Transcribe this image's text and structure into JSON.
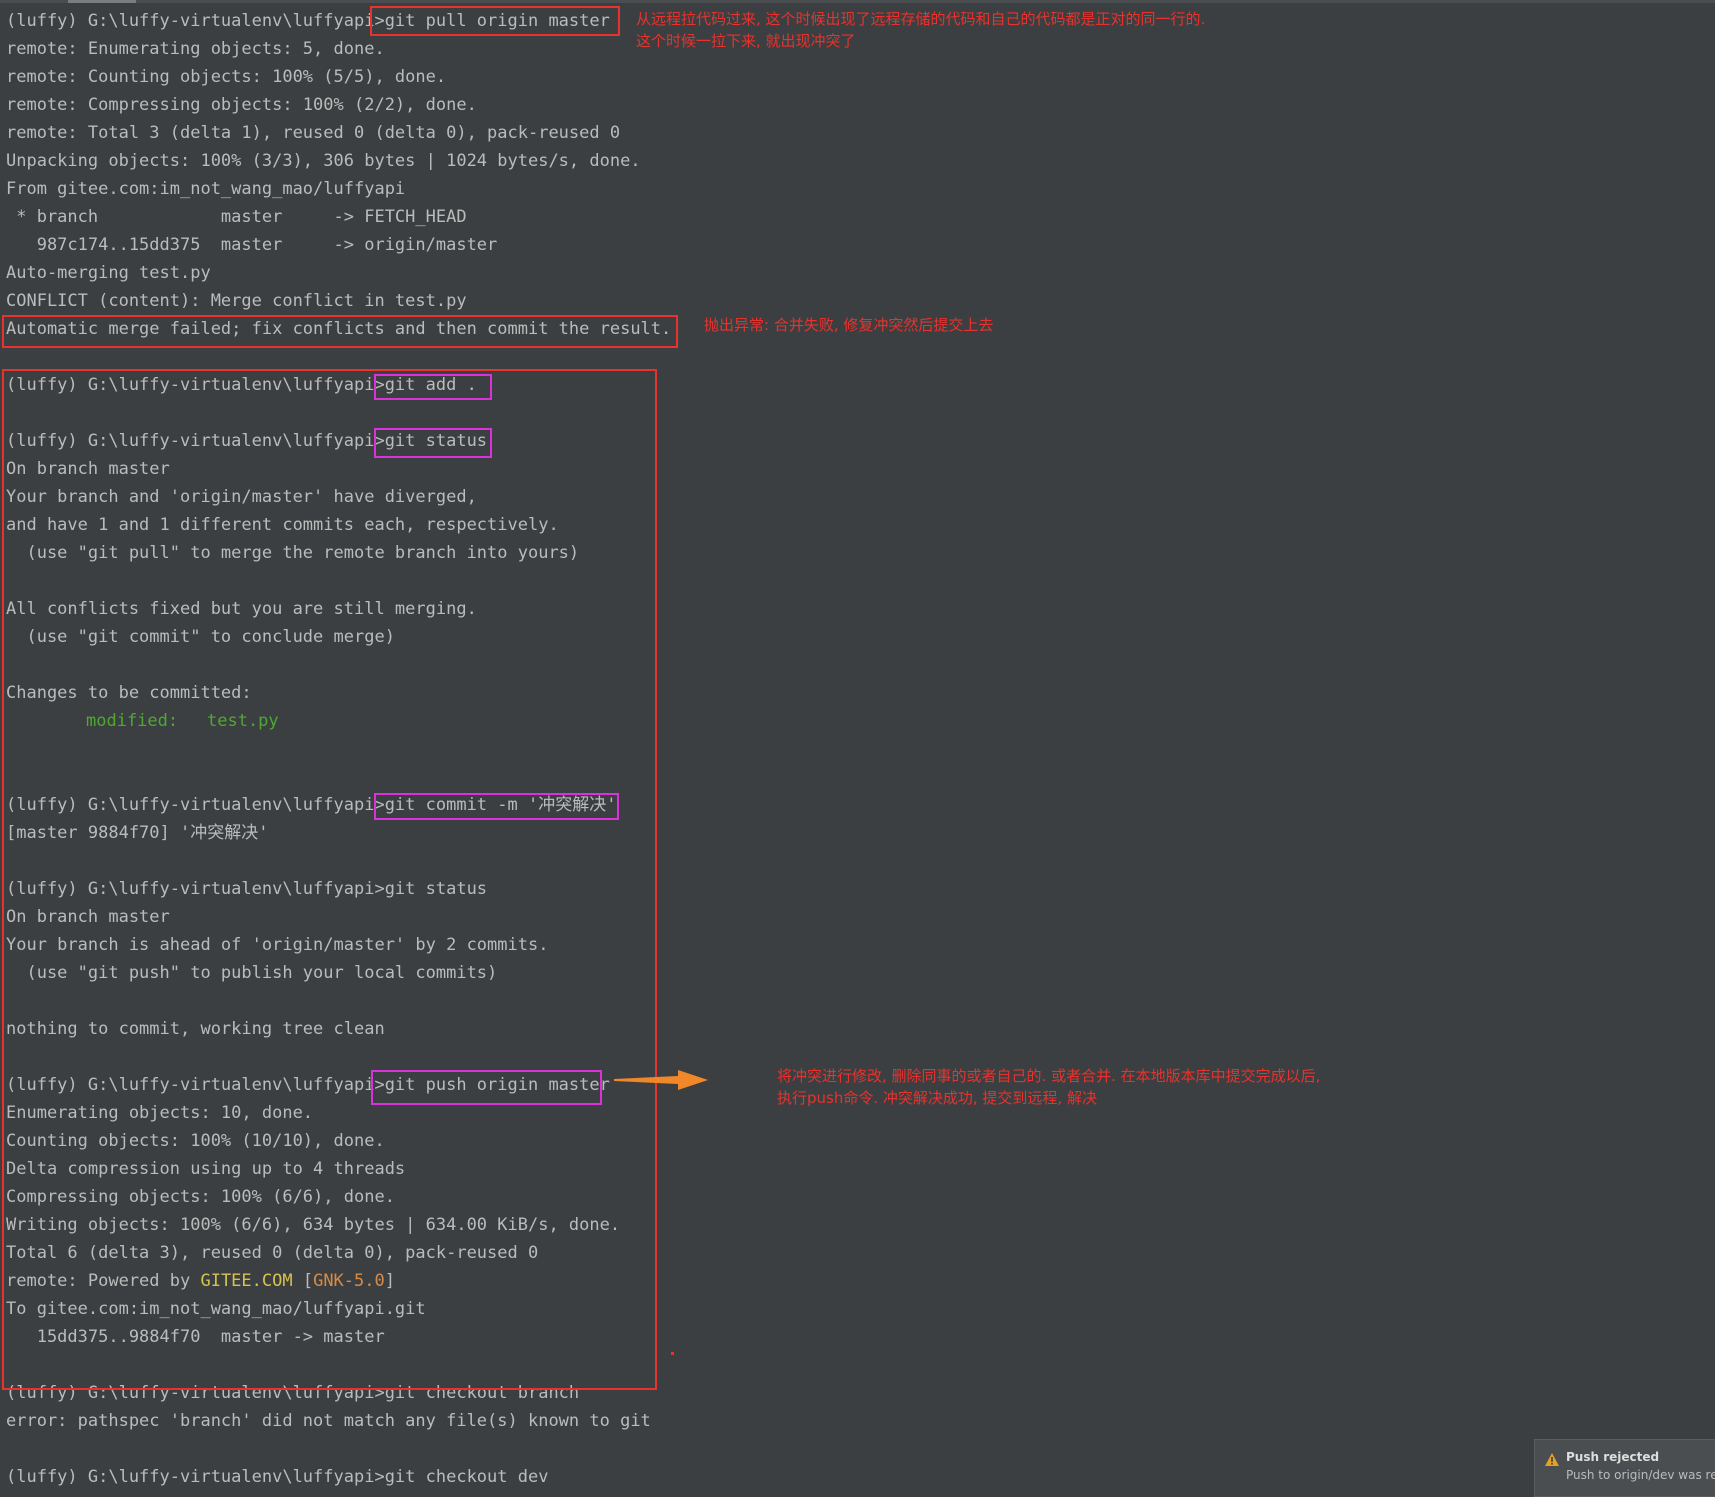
{
  "terminal": {
    "lines": [
      "(luffy) G:\\luffy-virtualenv\\luffyapi>git pull origin master",
      "remote: Enumerating objects: 5, done.",
      "remote: Counting objects: 100% (5/5), done.",
      "remote: Compressing objects: 100% (2/2), done.",
      "remote: Total 3 (delta 1), reused 0 (delta 0), pack-reused 0",
      "Unpacking objects: 100% (3/3), 306 bytes | 1024 bytes/s, done.",
      "From gitee.com:im_not_wang_mao/luffyapi",
      " * branch            master     -> FETCH_HEAD",
      "   987c174..15dd375  master     -> origin/master",
      "Auto-merging test.py",
      "CONFLICT (content): Merge conflict in test.py",
      "Automatic merge failed; fix conflicts and then commit the result.",
      "",
      "(luffy) G:\\luffy-virtualenv\\luffyapi>git add .",
      "",
      "(luffy) G:\\luffy-virtualenv\\luffyapi>git status",
      "On branch master",
      "Your branch and 'origin/master' have diverged,",
      "and have 1 and 1 different commits each, respectively.",
      "  (use \"git pull\" to merge the remote branch into yours)",
      "",
      "All conflicts fixed but you are still merging.",
      "  (use \"git commit\" to conclude merge)",
      "",
      "Changes to be committed:",
      "        modified:   test.py",
      "",
      "",
      "(luffy) G:\\luffy-virtualenv\\luffyapi>git commit -m '冲突解决'",
      "[master 9884f70] '冲突解决'",
      "",
      "(luffy) G:\\luffy-virtualenv\\luffyapi>git status",
      "On branch master",
      "Your branch is ahead of 'origin/master' by 2 commits.",
      "  (use \"git push\" to publish your local commits)",
      "",
      "nothing to commit, working tree clean",
      "",
      "(luffy) G:\\luffy-virtualenv\\luffyapi>git push origin master",
      "Enumerating objects: 10, done.",
      "Counting objects: 100% (10/10), done.",
      "Delta compression using up to 4 threads",
      "Compressing objects: 100% (6/6), done.",
      "Writing objects: 100% (6/6), 634 bytes | 634.00 KiB/s, done.",
      "Total 6 (delta 3), reused 0 (delta 0), pack-reused 0",
      "",
      "To gitee.com:im_not_wang_mao/luffyapi.git",
      "   15dd375..9884f70  master -> master",
      "",
      "(luffy) G:\\luffy-virtualenv\\luffyapi>git checkout branch",
      "error: pathspec 'branch' did not match any file(s) known to git",
      "",
      "(luffy) G:\\luffy-virtualenv\\luffyapi>git checkout dev"
    ],
    "modified_label": "modified:",
    "modified_file": "test.py",
    "powered_by": {
      "prefix": "remote: Powered by ",
      "site": "GITEE.COM",
      "open": " [",
      "tag": "GNK-5.0",
      "close": "]"
    },
    "colors": {
      "background": "#3c3f41",
      "text": "#bbbbbb",
      "green": "#4fa832",
      "yellow": "#d7c24f",
      "orange": "#d98a47",
      "annotation_red": "#e8322d",
      "annotation_pink": "#d832d8"
    }
  },
  "annotations": {
    "pull_note_1": "从远程拉代码过来, 这个时候出现了远程存储的代码和自己的代码都是正对的同一行的.",
    "pull_note_2": "这个时候一拉下来, 就出现冲突了",
    "error_note": "抛出异常: 合并失败, 修复冲突然后提交上去",
    "push_note_1": "将冲突进行修改, 删除同事的或者自己的. 或者合并. 在本地版本库中提交完成以后,",
    "push_note_2": "执行push命令. 冲突解决成功, 提交到远程, 解决"
  },
  "notification": {
    "icon": "warning-icon",
    "title": "Push rejected",
    "body": "Push to origin/dev was rejected"
  }
}
